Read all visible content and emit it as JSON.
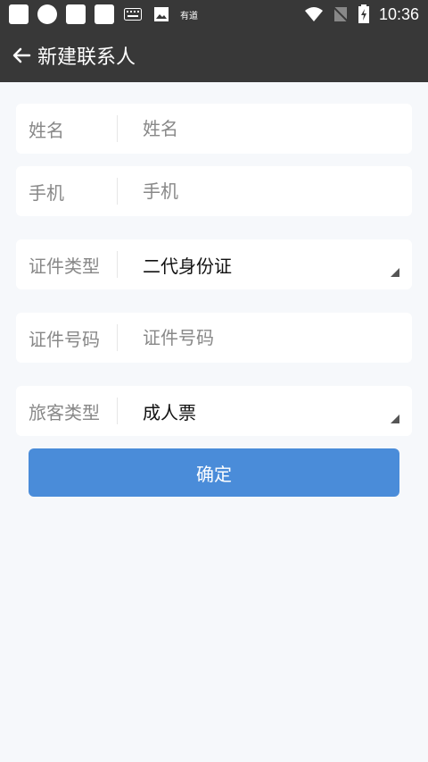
{
  "status_bar": {
    "time": "10:36",
    "icons": [
      "square-icon",
      "circle-icon",
      "square-icon",
      "square-icon",
      "keyboard-icon",
      "image-icon",
      "youdao-text-icon",
      "wifi-icon",
      "no-sim-icon",
      "battery-charging-icon"
    ],
    "youdao_text": "有道"
  },
  "app_bar": {
    "title": "新建联系人",
    "back_icon": "arrow-left-icon"
  },
  "form": {
    "name": {
      "label": "姓名",
      "placeholder": "姓名"
    },
    "phone": {
      "label": "手机",
      "placeholder": "手机"
    },
    "id_type": {
      "label": "证件类型",
      "value": "二代身份证"
    },
    "id_number": {
      "label": "证件号码",
      "placeholder": "证件号码"
    },
    "passenger_type": {
      "label": "旅客类型",
      "value": "成人票"
    }
  },
  "buttons": {
    "confirm": "确定"
  },
  "colors": {
    "header_bg": "#383838",
    "page_bg": "#f6f8fb",
    "primary": "#4a8cd9"
  }
}
